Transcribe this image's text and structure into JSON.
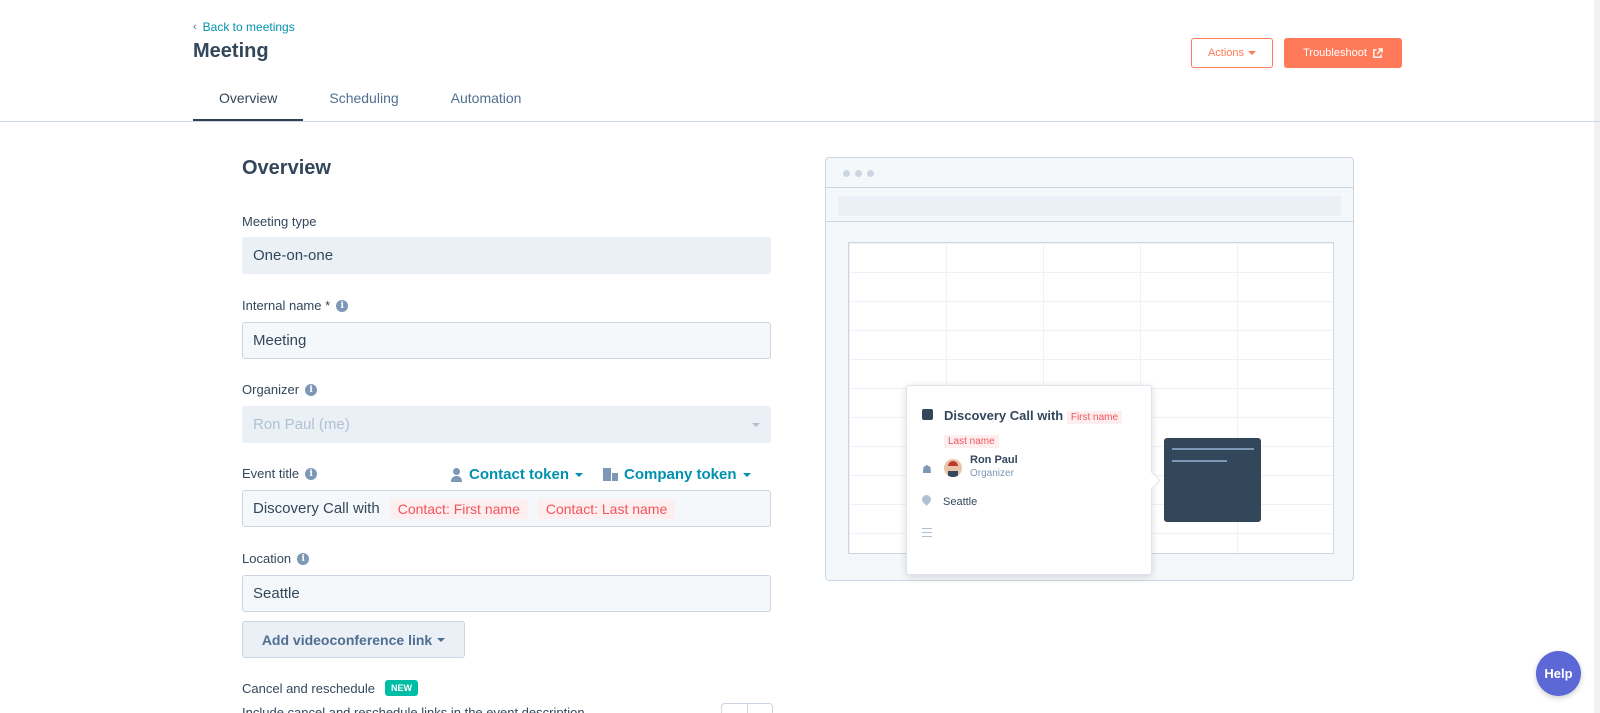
{
  "header": {
    "back_link": "Back to meetings",
    "title": "Meeting",
    "actions_label": "Actions",
    "troubleshoot_label": "Troubleshoot"
  },
  "tabs": [
    {
      "label": "Overview",
      "active": true
    },
    {
      "label": "Scheduling",
      "active": false
    },
    {
      "label": "Automation",
      "active": false
    }
  ],
  "form": {
    "section_title": "Overview",
    "meeting_type": {
      "label": "Meeting type",
      "value": "One-on-one"
    },
    "internal_name": {
      "label": "Internal name *",
      "value": "Meeting"
    },
    "organizer": {
      "label": "Organizer",
      "value": "Ron Paul (me)"
    },
    "event_title": {
      "label": "Event title",
      "prefix": "Discovery Call with",
      "tokens": [
        "Contact: First name",
        "Contact: Last name"
      ],
      "contact_token_label": "Contact token",
      "company_token_label": "Company token"
    },
    "location": {
      "label": "Location",
      "value": "Seattle"
    },
    "videoconference_button": "Add videoconference link",
    "cancel_reschedule": {
      "label": "Cancel and reschedule",
      "badge": "NEW",
      "help": "Include cancel and reschedule links in the event description"
    }
  },
  "preview": {
    "event_title": "Discovery Call with",
    "token_first": "First name",
    "token_last": "Last name",
    "organizer_name": "Ron Paul",
    "organizer_role": "Organizer",
    "location": "Seattle"
  },
  "help_button": "Help",
  "colors": {
    "accent": "#ff7a59",
    "link": "#0091ae",
    "text": "#33475b",
    "token": "#f2545b",
    "badge": "#00bda5",
    "help": "#5b68d6"
  }
}
